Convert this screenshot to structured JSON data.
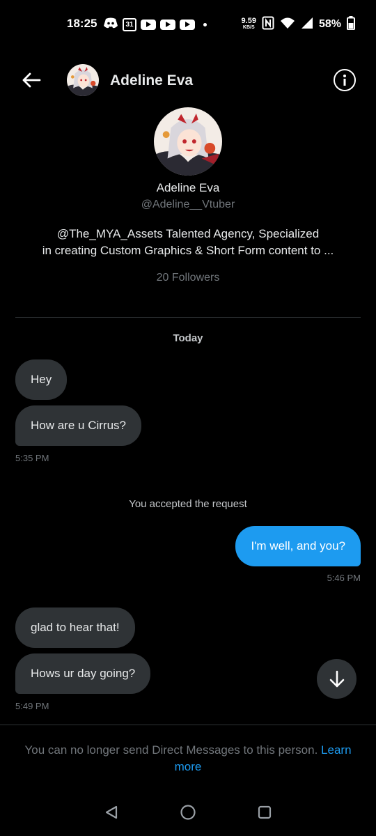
{
  "status_bar": {
    "time": "18:25",
    "calendar_day": "31",
    "net_speed": "9.59",
    "net_unit": "KB/S",
    "battery": "58%",
    "icons": [
      "discord-icon",
      "calendar-icon",
      "youtube-icon",
      "youtube-icon",
      "youtube-icon",
      "notification-dot",
      "nfc-icon",
      "wifi-icon",
      "signal-icon",
      "battery-icon"
    ]
  },
  "header": {
    "name": "Adeline Eva"
  },
  "profile": {
    "name": "Adeline Eva",
    "handle": "@Adeline__Vtuber",
    "bio_line1": "@The_MYA_Assets Talented Agency, Specialized",
    "bio_line2": "in creating Custom Graphics & Short Form content to  ...",
    "followers": "20 Followers"
  },
  "conversation": {
    "date_label": "Today",
    "messages": [
      {
        "text": "Hey",
        "direction": "in"
      },
      {
        "text": "How are u Cirrus?",
        "direction": "in"
      },
      {
        "time": "5:35 PM"
      },
      {
        "system": "You accepted the request"
      },
      {
        "text": "I'm well, and you?",
        "direction": "out"
      },
      {
        "time": "5:46 PM"
      },
      {
        "text": "glad to hear that!",
        "direction": "in"
      },
      {
        "text": "Hows ur day going?",
        "direction": "in"
      },
      {
        "time": "5:49 PM"
      }
    ]
  },
  "notice": {
    "text": "You can no longer send Direct Messages to this person.",
    "link": "Learn more"
  },
  "colors": {
    "background": "#000000",
    "incoming_bubble": "#2f3336",
    "outgoing_bubble": "#1d9bf0",
    "muted_text": "#71767b",
    "link": "#1d9bf0"
  }
}
